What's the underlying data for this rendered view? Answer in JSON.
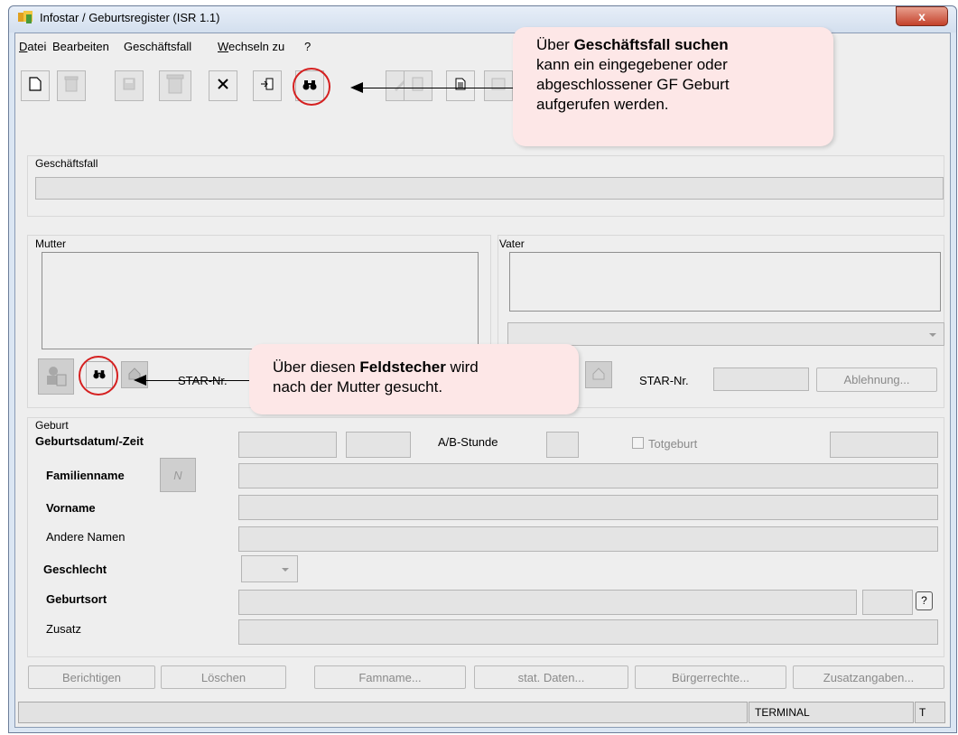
{
  "window": {
    "title": "Infostar / Geburtsregister (ISR 1.1)",
    "close_label": "x"
  },
  "menu": {
    "items": [
      {
        "label": "Datei"
      },
      {
        "label": "Bearbeiten"
      },
      {
        "label": "Geschäftsfall"
      },
      {
        "label": "Wechseln zu"
      },
      {
        "label": "?"
      }
    ]
  },
  "toolbar": {
    "buttons": [
      {
        "icon": "new-document-icon",
        "enabled": true
      },
      {
        "icon": "trash-icon",
        "enabled": false
      },
      {
        "icon": "save-icon",
        "enabled": false
      },
      {
        "icon": "trash-can-icon",
        "enabled": false
      },
      {
        "icon": "delete-x-icon",
        "enabled": true
      },
      {
        "icon": "exit-icon",
        "enabled": true
      },
      {
        "icon": "binoculars-icon",
        "enabled": true
      },
      {
        "icon": "edit-icon",
        "enabled": false
      },
      {
        "icon": "copy-document-icon",
        "enabled": false
      },
      {
        "icon": "document-icon",
        "enabled": true
      },
      {
        "icon": "form-icon",
        "enabled": false
      }
    ]
  },
  "callouts": {
    "top": {
      "line1_prefix": "Über ",
      "line1_bold": "Geschäftsfall suchen",
      "line2": "kann ein eingegebener oder",
      "line3": "abgeschlossener GF Geburt",
      "line4": "aufgerufen werden."
    },
    "bottom": {
      "line1_prefix": "Über diesen ",
      "line1_bold": "Feldstecher",
      "line1_suffix": " wird",
      "line2": "nach der Mutter gesucht."
    }
  },
  "geschaeftsfall": {
    "label": "Geschäftsfall",
    "value": ""
  },
  "mutter": {
    "label": "Mutter",
    "star_label": "STAR-Nr."
  },
  "vater": {
    "label": "Vater",
    "star_label": "STAR-Nr.",
    "ablehnung_label": "Ablehnung..."
  },
  "geburt": {
    "section_label": "Geburt",
    "datum_label": "Geburtsdatum/-Zeit",
    "ab_stunde_label": "A/B-Stunde",
    "totgeburt_label": "Totgeburt",
    "familienname_label": "Familienname",
    "n_button_label": "N",
    "vorname_label": "Vorname",
    "andere_namen_label": "Andere Namen",
    "geschlecht_label": "Geschlecht",
    "geburtsort_label": "Geburtsort",
    "help_label": "?",
    "zusatz_label": "Zusatz"
  },
  "actions": {
    "berichtigen": "Berichtigen",
    "loeschen": "Löschen",
    "famname": "Famname...",
    "stat_daten": "stat. Daten...",
    "buergerrechte": "Bürgerrechte...",
    "zusatzangaben": "Zusatzangaben..."
  },
  "status": {
    "terminal": "TERMINAL",
    "t": "T"
  },
  "colors": {
    "callout_bg": "#fde7e7",
    "highlight_circle": "#d52020"
  }
}
